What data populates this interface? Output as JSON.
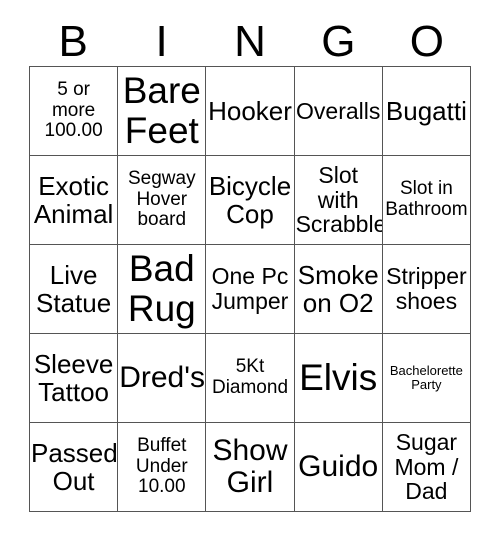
{
  "card": {
    "header_letters": [
      "B",
      "I",
      "N",
      "G",
      "O"
    ],
    "grid": {
      "columns": 5,
      "rows": 5,
      "border_color": "#555555",
      "background_color": "#ffffff",
      "text_color": "#000000"
    },
    "cells": [
      {
        "text": "5 or\nmore\n100.00",
        "size": "fs-sm"
      },
      {
        "text": "Bare\nFeet",
        "size": "fs-xxl"
      },
      {
        "text": "Hooker",
        "size": "fs-lg"
      },
      {
        "text": "Overalls",
        "size": "fs-md"
      },
      {
        "text": "Bugatti",
        "size": "fs-lg"
      },
      {
        "text": "Exotic\nAnimal",
        "size": "fs-lg"
      },
      {
        "text": "Segway\nHover\nboard",
        "size": "fs-sm"
      },
      {
        "text": "Bicycle\nCop",
        "size": "fs-lg"
      },
      {
        "text": "Slot with\nScrabble",
        "size": "fs-md"
      },
      {
        "text": "Slot in\nBathroom",
        "size": "fs-sm"
      },
      {
        "text": "Live\nStatue",
        "size": "fs-lg"
      },
      {
        "text": "Bad\nRug",
        "size": "fs-xxl"
      },
      {
        "text": "One Pc\nJumper",
        "size": "fs-md"
      },
      {
        "text": "Smoke\non O2",
        "size": "fs-lg"
      },
      {
        "text": "Stripper\nshoes",
        "size": "fs-md"
      },
      {
        "text": "Sleeve\nTattoo",
        "size": "fs-lg"
      },
      {
        "text": "Dred's",
        "size": "fs-xl"
      },
      {
        "text": "5Kt\nDiamond",
        "size": "fs-sm"
      },
      {
        "text": "Elvis",
        "size": "fs-xxl"
      },
      {
        "text": "Bachelorette\nParty",
        "size": "fs-xxs"
      },
      {
        "text": "Passed\nOut",
        "size": "fs-lg"
      },
      {
        "text": "Buffet\nUnder\n10.00",
        "size": "fs-sm"
      },
      {
        "text": "Show\nGirl",
        "size": "fs-xl"
      },
      {
        "text": "Guido",
        "size": "fs-xl"
      },
      {
        "text": "Sugar\nMom /\nDad",
        "size": "fs-md"
      }
    ]
  }
}
